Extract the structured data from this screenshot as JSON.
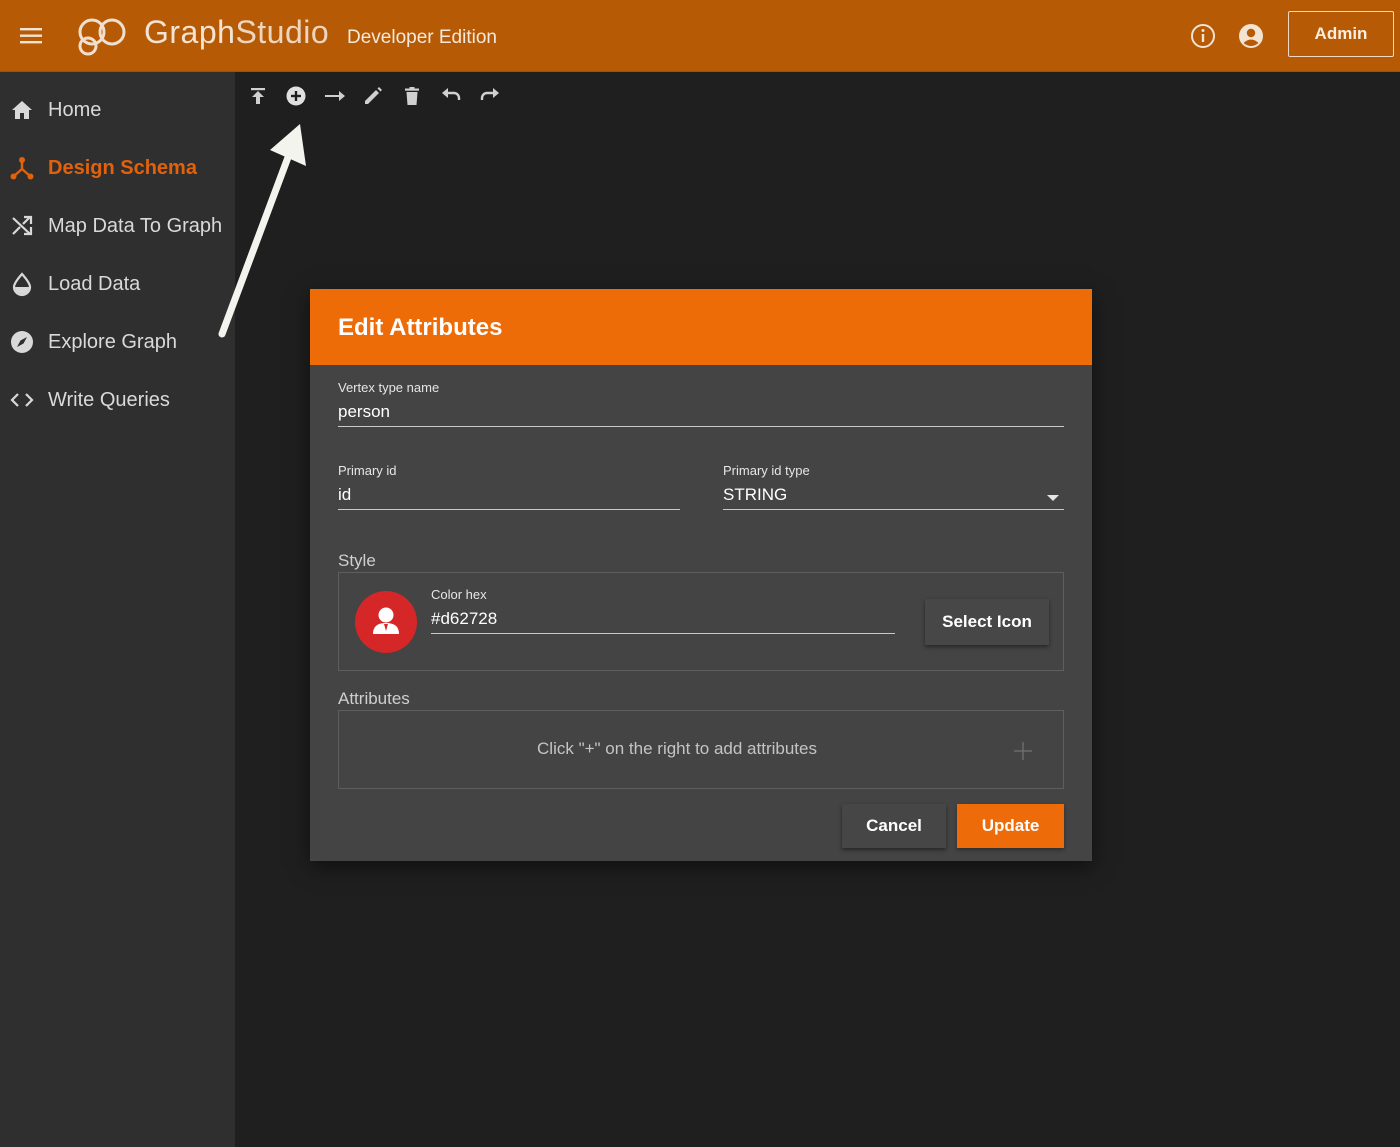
{
  "header": {
    "brand_main": "Graph",
    "brand_light": "Studio",
    "edition": "Developer Edition",
    "admin_label": "Admin",
    "icons": [
      "menu-icon",
      "graphstudio-logo",
      "info-icon",
      "account-icon"
    ]
  },
  "sidebar": {
    "items": [
      {
        "label": "Home",
        "icon": "home-icon",
        "active": false
      },
      {
        "label": "Design Schema",
        "icon": "schema-icon",
        "active": true
      },
      {
        "label": "Map Data To Graph",
        "icon": "shuffle-icon",
        "active": false
      },
      {
        "label": "Load Data",
        "icon": "drop-icon",
        "active": false
      },
      {
        "label": "Explore Graph",
        "icon": "compass-icon",
        "active": false
      },
      {
        "label": "Write Queries",
        "icon": "code-icon",
        "active": false
      }
    ]
  },
  "toolbar": {
    "tools": [
      "publish-icon",
      "add-vertex-icon",
      "add-edge-icon",
      "edit-icon",
      "delete-icon",
      "undo-icon",
      "redo-icon"
    ]
  },
  "dialog": {
    "title": "Edit Attributes",
    "vertex_type_label": "Vertex type name",
    "vertex_type_value": "person",
    "primary_id_label": "Primary id",
    "primary_id_value": "id",
    "primary_id_type_label": "Primary id type",
    "primary_id_type_value": "STRING",
    "style_label": "Style",
    "color_hex_label": "Color hex",
    "color_hex_value": "#d62728",
    "select_icon_label": "Select Icon",
    "attributes_label": "Attributes",
    "attributes_hint": "Click \"+\" on the right to add attributes",
    "cancel_label": "Cancel",
    "update_label": "Update"
  },
  "colors": {
    "topbar": "#b65a05",
    "accent": "#ed6c07",
    "active_nav": "#e2620b",
    "vertex_color": "#d62728"
  }
}
